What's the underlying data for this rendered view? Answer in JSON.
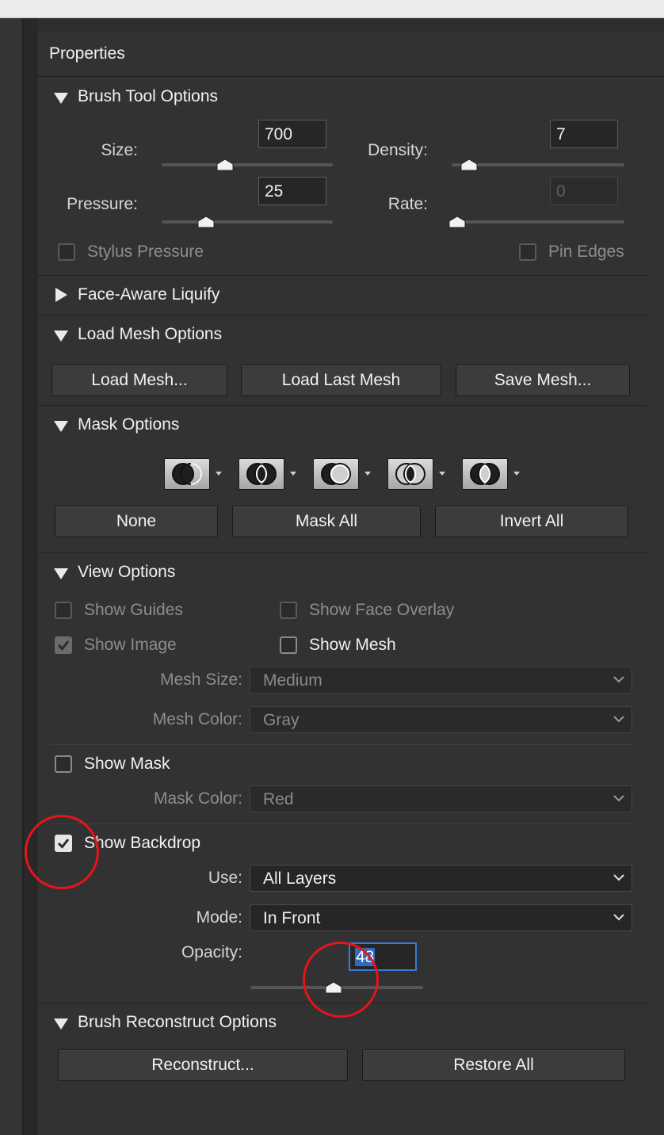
{
  "panel": {
    "title": "Properties"
  },
  "brush_tool": {
    "title": "Brush Tool Options",
    "size": {
      "label": "Size:",
      "value": "700",
      "level": 0.37
    },
    "density": {
      "label": "Density:",
      "value": "7",
      "level": 0.1
    },
    "pressure": {
      "label": "Pressure:",
      "value": "25",
      "level": 0.26
    },
    "rate": {
      "label": "Rate:",
      "value": "0",
      "level": 0.03
    },
    "stylus_pressure": "Stylus Pressure",
    "pin_edges": "Pin Edges"
  },
  "face_aware": {
    "title": "Face-Aware Liquify"
  },
  "load_mesh": {
    "title": "Load Mesh Options",
    "load_mesh_button": "Load Mesh...",
    "load_last_mesh_button": "Load Last Mesh",
    "save_mesh_button": "Save Mesh..."
  },
  "mask_options": {
    "title": "Mask Options",
    "mode_icons": [
      "mask-replace-icon",
      "mask-add-icon",
      "mask-subtract-icon",
      "mask-intersect-icon",
      "mask-invert-icon"
    ],
    "none_button": "None",
    "mask_all_button": "Mask All",
    "invert_all_button": "Invert All"
  },
  "view_options": {
    "title": "View Options",
    "show_guides": "Show Guides",
    "show_face_overlay": "Show Face Overlay",
    "show_image": "Show Image",
    "show_mesh": "Show Mesh",
    "mesh_size_label": "Mesh Size:",
    "mesh_size_value": "Medium",
    "mesh_color_label": "Mesh Color:",
    "mesh_color_value": "Gray",
    "show_mask": "Show Mask",
    "mask_color_label": "Mask Color:",
    "mask_color_value": "Red",
    "show_backdrop": "Show Backdrop",
    "use_label": "Use:",
    "use_value": "All Layers",
    "mode_label": "Mode:",
    "mode_value": "In Front",
    "opacity_label": "Opacity:",
    "opacity_value": "48",
    "opacity_level": 0.48
  },
  "brush_reconstruct": {
    "title": "Brush Reconstruct Options",
    "reconstruct_button": "Reconstruct...",
    "restore_all_button": "Restore All"
  },
  "colors": {
    "panel_bg": "#323232",
    "highlight_circle": "#e8141a",
    "selection": "#2f6bbf"
  }
}
